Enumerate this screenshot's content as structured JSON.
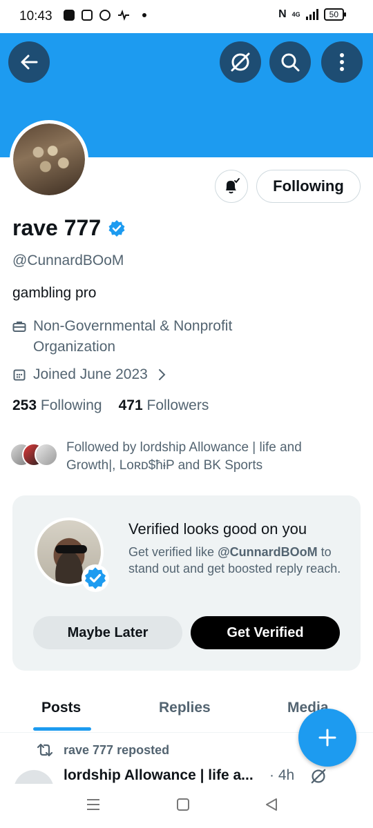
{
  "status_bar": {
    "time": "10:43",
    "network": "4G",
    "battery": "50"
  },
  "profile": {
    "display_name": "rave 777",
    "handle": "@CunnardBOoM",
    "bio": "gambling pro",
    "category_line1": "Non-Governmental & Nonprofit",
    "category_line2": "Organization",
    "joined": "Joined June 2023",
    "following_count": "253",
    "following_label": "Following",
    "followers_count": "471",
    "followers_label": "Followers",
    "followed_by_line1": "Followed by lordship Allowance | life and",
    "followed_by_line2": "Growth|, Lᴏʀᴅ$ħɨP and BK Sports"
  },
  "actions": {
    "following_button": "Following"
  },
  "verified_card": {
    "title": "Verified looks good on you",
    "desc_prefix": "Get verified like ",
    "desc_handle": "@CunnardBOoM",
    "desc_suffix": " to stand out and get boosted reply reach.",
    "maybe_later": "Maybe Later",
    "get_verified": "Get Verified"
  },
  "tabs": [
    "Posts",
    "Replies",
    "Media"
  ],
  "feed": {
    "repost_label": "rave 777 reposted",
    "post_author": "lordship Allowance | life a...",
    "post_time": "· 4h"
  },
  "colors": {
    "accent": "#1d9bf0",
    "banner": "#1d9bf0",
    "header_button": "#1e4d73",
    "text_primary": "#0f1419",
    "text_secondary": "#536471",
    "card_bg": "#eff3f4"
  },
  "icons": [
    "back-arrow-icon",
    "grok-icon",
    "search-icon",
    "more-vertical-icon",
    "bell-check-icon",
    "verified-badge-icon",
    "briefcase-icon",
    "calendar-icon",
    "chevron-right-icon",
    "repost-icon",
    "plus-icon"
  ]
}
